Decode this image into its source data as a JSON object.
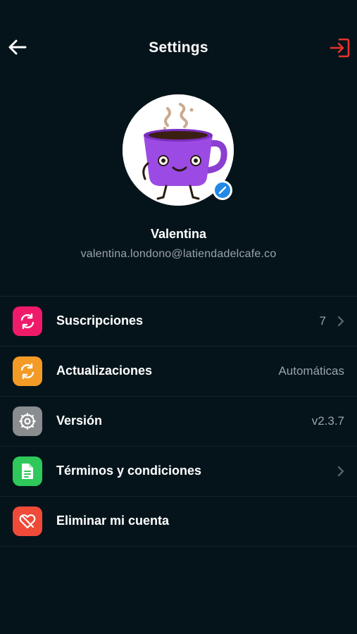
{
  "header": {
    "title": "Settings"
  },
  "profile": {
    "name": "Valentina",
    "email": "valentina.londono@latiendadelcafe.co"
  },
  "settings": {
    "subscriptions": {
      "label": "Suscripciones",
      "value": "7",
      "icon": "sync-icon",
      "color": "#ef1b6a"
    },
    "updates": {
      "label": "Actualizaciones",
      "value": "Automáticas",
      "icon": "sync-icon",
      "color": "#f39b26"
    },
    "version": {
      "label": "Versión",
      "value": "v2.3.7",
      "icon": "gear-icon",
      "color": "#8a8d90"
    },
    "terms": {
      "label": "Términos y condiciones",
      "icon": "document-icon",
      "color": "#2ec95a"
    },
    "delete": {
      "label": "Eliminar mi cuenta",
      "icon": "broken-heart-icon",
      "color": "#f04a38"
    }
  },
  "colors": {
    "background": "#05141b",
    "logout_accent": "#e8332a",
    "edit_badge": "#2288e6",
    "secondary_text": "#9aa3a8"
  }
}
